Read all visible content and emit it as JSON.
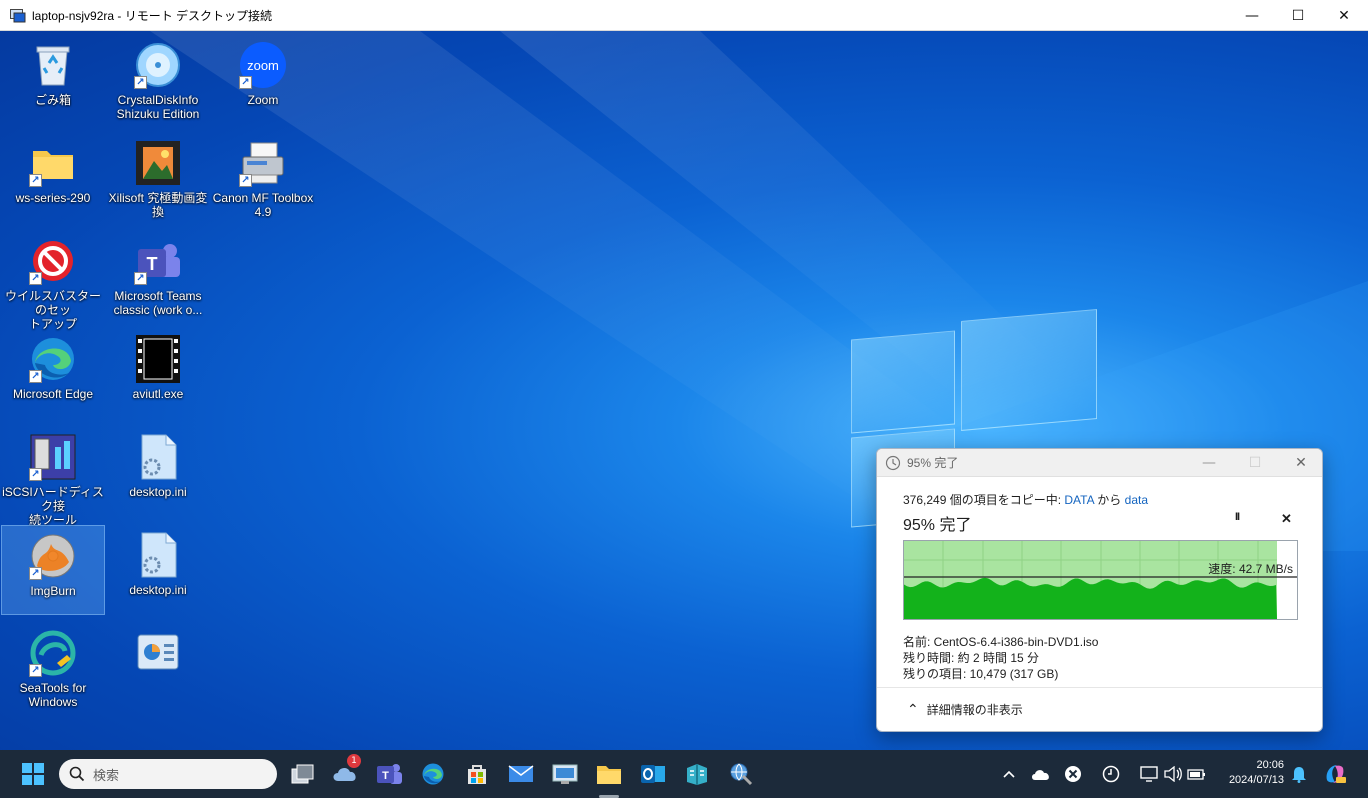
{
  "rdp_window": {
    "title": "laptop-nsjv92ra - リモート デスクトップ接続",
    "minimize_glyph": "—",
    "maximize_glyph": "☐",
    "close_glyph": "✕"
  },
  "desktop_icons": [
    {
      "label": "ごみ箱",
      "icon": "recycle-bin-icon"
    },
    {
      "label": "CrystalDiskInfo\nShizuku Edition",
      "icon": "crystaldiskinfo-icon"
    },
    {
      "label": "Zoom",
      "icon": "zoom-icon",
      "icon_text": "zoom"
    },
    {
      "label": "ws-series-290",
      "icon": "folder-icon"
    },
    {
      "label": "Xilisoft 究極動画変\n換",
      "icon": "xilisoft-icon"
    },
    {
      "label": "Canon MF Toolbox\n4.9",
      "icon": "canon-toolbox-icon"
    },
    {
      "label": "ウイルスバスターのセッ\nトアップ",
      "icon": "virusbuster-icon"
    },
    {
      "label": "Microsoft Teams\nclassic (work o...",
      "icon": "teams-icon",
      "icon_text": "T"
    },
    {
      "label": "Microsoft Edge",
      "icon": "edge-icon"
    },
    {
      "label": "aviutl.exe",
      "icon": "aviutl-icon"
    },
    {
      "label": "iSCSIハードディスク接\n続ツール",
      "icon": "iscsi-icon"
    },
    {
      "label": "desktop.ini",
      "icon": "settings-file-icon"
    },
    {
      "label": "ImgBurn",
      "icon": "imgburn-icon"
    },
    {
      "label": "desktop.ini",
      "icon": "settings-file-icon"
    },
    {
      "label": "SeaTools for\nWindows",
      "icon": "seatools-icon"
    },
    {
      "label": "",
      "icon": "control-panel-icon"
    }
  ],
  "copy_dialog": {
    "title": "95% 完了",
    "count_text": "376,249 個の項目をコピー中:",
    "source": "DATA",
    "from_word": "から",
    "dest": "data",
    "heading": "95% 完了",
    "pause_glyph": "II",
    "cancel_glyph": "✕",
    "speed": "速度: 42.7 MB/s",
    "progress_percent": 95,
    "name_line": "名前:  CentOS-6.4-i386-bin-DVD1.iso",
    "time_line": "残り時間:  約 2 時間 15 分",
    "items_line": "残りの項目:  10,479 (317 GB)",
    "toggle_glyph": "⌃",
    "details_toggle": "詳細情報の非表示"
  },
  "taskbar": {
    "search_placeholder": "検索",
    "notification_badge": "1",
    "time": "20:06",
    "date": "2024/07/13",
    "pinned": [
      "task-view-icon",
      "weather-icon",
      "teams-icon",
      "edge-icon",
      "store-icon",
      "mail-icon",
      "remote-desktop-icon",
      "file-explorer-icon",
      "outlook-icon",
      "app-icon",
      "network-globe-icon"
    ]
  }
}
